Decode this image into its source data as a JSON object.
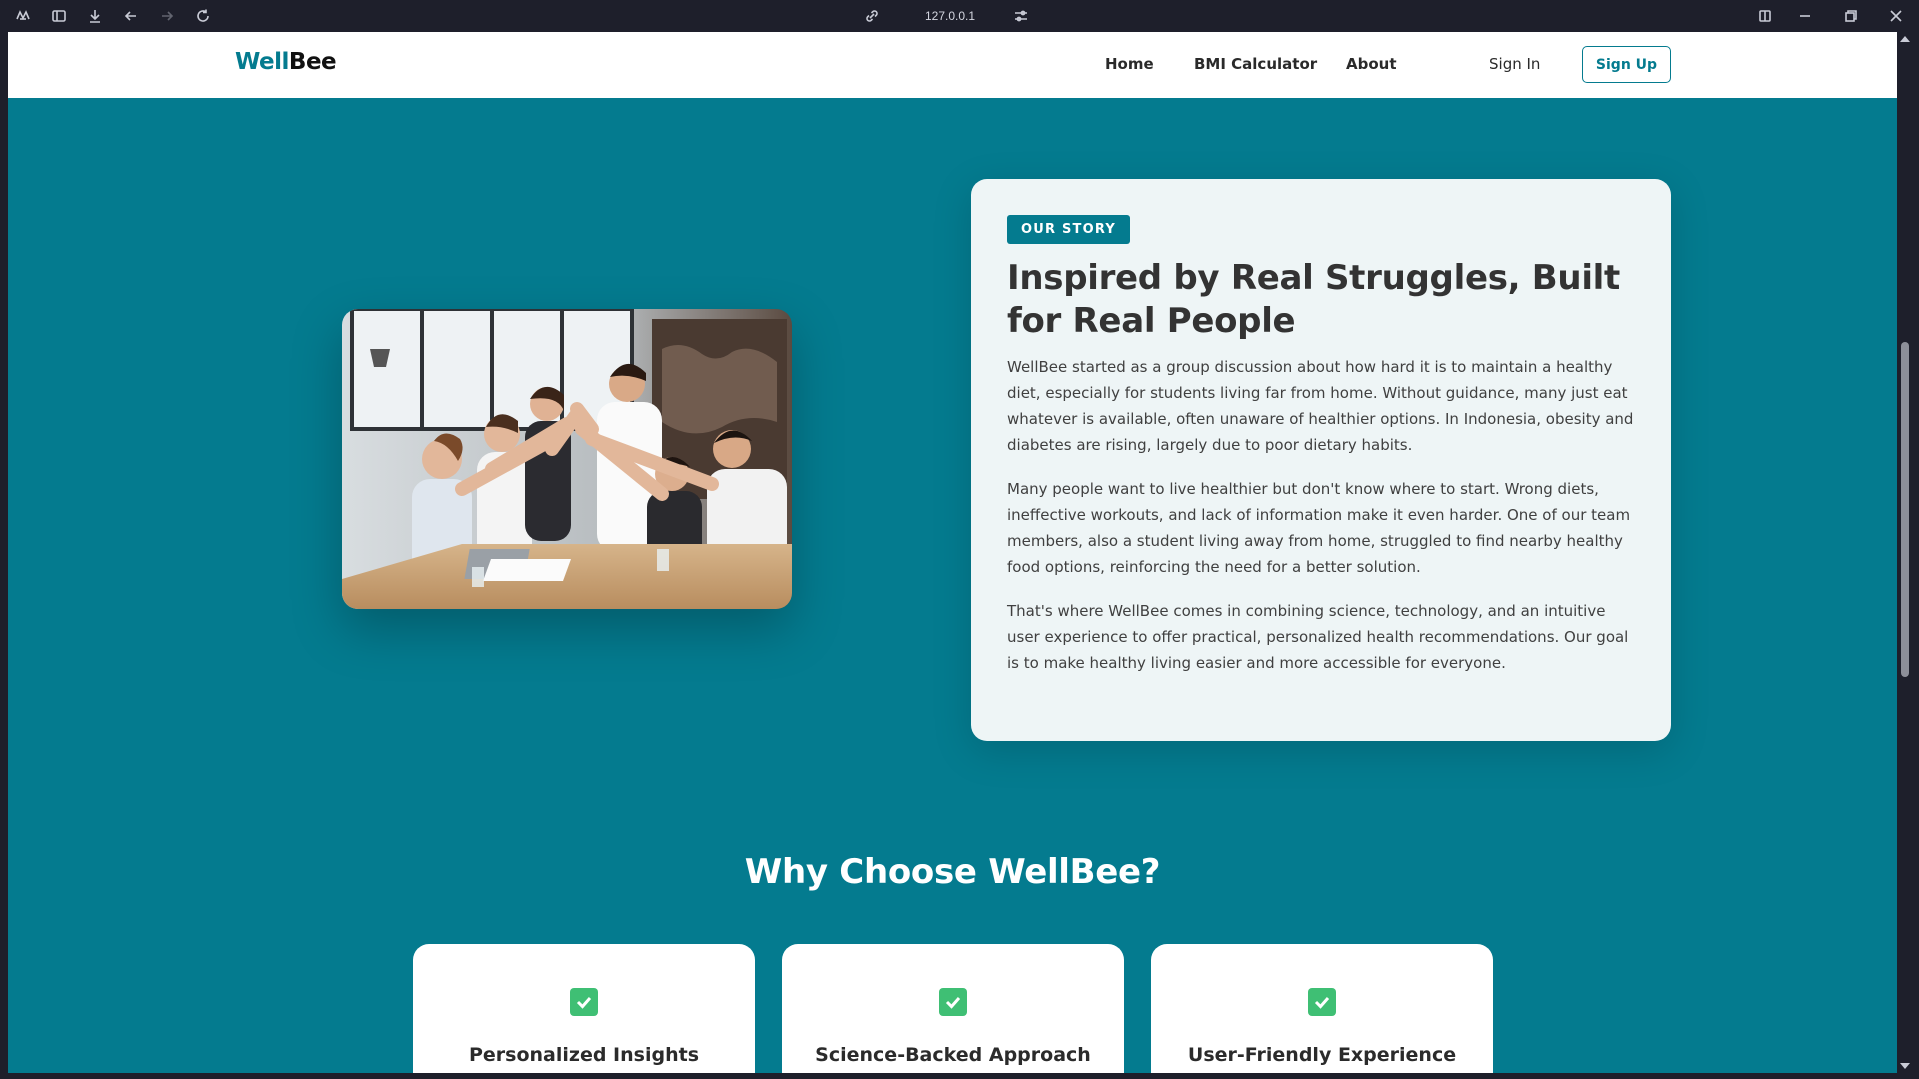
{
  "browser": {
    "url": "127.0.0.1"
  },
  "brand": {
    "part1": "Well",
    "part2": "Bee",
    "accent_color": "#047b8f"
  },
  "nav": {
    "links": [
      "Home",
      "BMI Calculator",
      "About"
    ],
    "sign_in": "Sign In",
    "sign_up": "Sign Up"
  },
  "story": {
    "badge": "OUR STORY",
    "title": "Inspired by Real Struggles, Built for Real People",
    "paragraphs": [
      "WellBee started as a group discussion about how hard it is to maintain a healthy diet, especially for students living far from home. Without guidance, many just eat whatever is available, often unaware of healthier options. In Indonesia, obesity and diabetes are rising, largely due to poor dietary habits.",
      "Many people want to live healthier but don't know where to start. Wrong diets, ineffective workouts, and lack of information make it even harder. One of our team members, also a student living away from home, struggled to find nearby healthy food options, reinforcing the need for a better solution.",
      "That's where WellBee comes in combining science, technology, and an intuitive user experience to offer practical, personalized health recommendations. Our goal is to make healthy living easier and more accessible for everyone."
    ]
  },
  "why": {
    "title": "Why Choose WellBee?",
    "features": [
      "Personalized Insights",
      "Science-Backed Approach",
      "User-Friendly Experience"
    ]
  }
}
